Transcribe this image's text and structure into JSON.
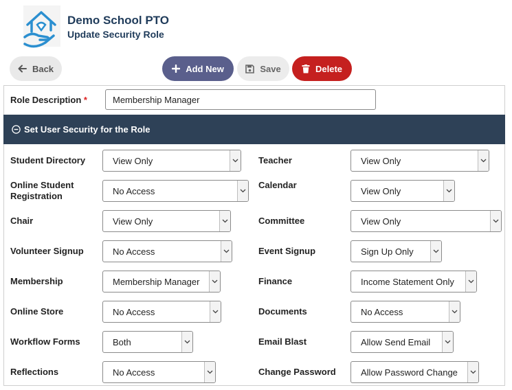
{
  "header": {
    "org_title": "Demo School PTO",
    "page_title": "Update Security Role",
    "logo_icon": "house-hand-icon"
  },
  "toolbar": {
    "back_label": "Back",
    "add_label": "Add New",
    "save_label": "Save",
    "delete_label": "Delete"
  },
  "role": {
    "label": "Role Description",
    "required_mark": "*",
    "value": "Membership Manager"
  },
  "section": {
    "title": "Set User Security for the Role"
  },
  "permissions": {
    "left": [
      {
        "label": "Student Directory",
        "value": "View Only"
      },
      {
        "label": "Online Student Registration",
        "value": "No Access"
      },
      {
        "label": "Chair",
        "value": "View Only"
      },
      {
        "label": "Volunteer Signup",
        "value": "No Access"
      },
      {
        "label": "Membership",
        "value": "Membership Manager"
      },
      {
        "label": "Online Store",
        "value": "No Access"
      },
      {
        "label": "Workflow Forms",
        "value": "Both"
      },
      {
        "label": "Reflections",
        "value": "No Access"
      }
    ],
    "right": [
      {
        "label": "Teacher",
        "value": "View Only"
      },
      {
        "label": "Calendar",
        "value": "View Only"
      },
      {
        "label": "Committee",
        "value": "View Only"
      },
      {
        "label": "Event Signup",
        "value": "Sign Up Only"
      },
      {
        "label": "Finance",
        "value": "Income Statement Only"
      },
      {
        "label": "Documents",
        "value": "No Access"
      },
      {
        "label": "Email Blast",
        "value": "Allow Send Email"
      },
      {
        "label": "Change Password",
        "value": "Allow Password Change"
      }
    ]
  },
  "colors": {
    "brand": "#1f3b5a",
    "section_bar": "#2e4157",
    "add_button": "#5a5f8c",
    "delete_button": "#c5201f",
    "logo": "#2b8fd0"
  }
}
